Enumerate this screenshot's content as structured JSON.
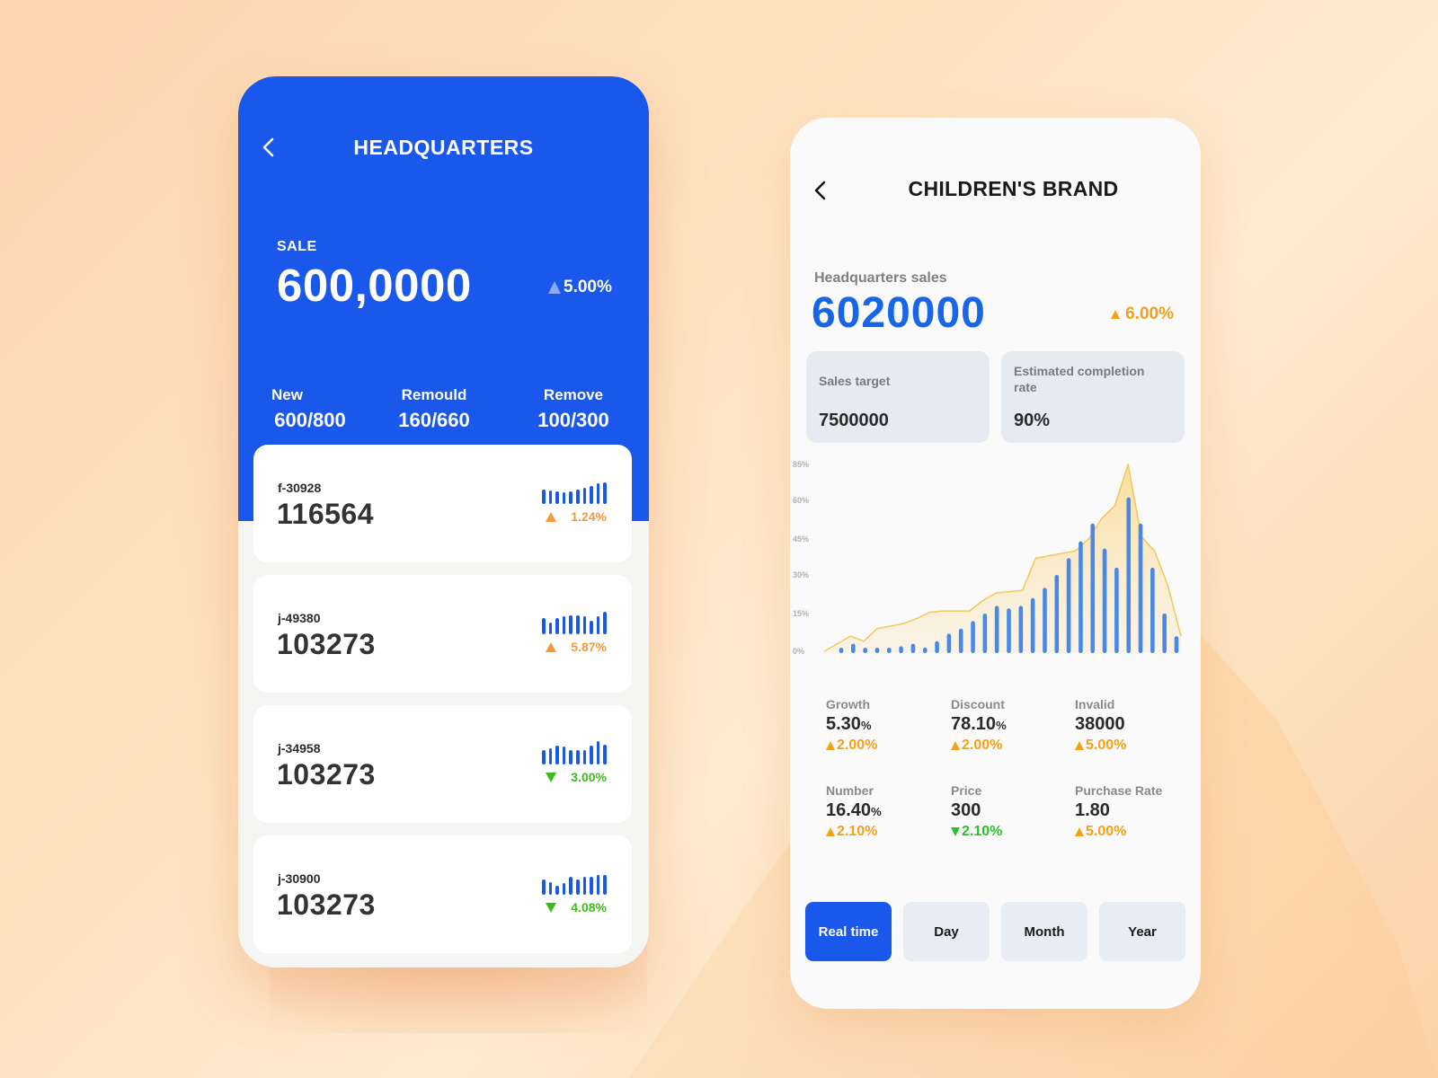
{
  "colors": {
    "brand_blue": "#1a58eb",
    "accent_orange": "#f5a018",
    "up_orange": "#f59a3c",
    "down_green": "#3dbb1a",
    "area_fill": "#f9d98a",
    "area_line": "#f3c75a",
    "bar_blue": "#4a88e8"
  },
  "headquarters": {
    "back_icon": "chevron-left-icon",
    "title": "HEADQUARTERS",
    "sale_label": "SALE",
    "sale_value": "600,0000",
    "sale_change": "5.00%",
    "sale_change_direction": "up",
    "stats": [
      {
        "label": "New",
        "value": "600/800"
      },
      {
        "label": "Remould",
        "value": "160/660"
      },
      {
        "label": "Remove",
        "value": "100/300"
      }
    ],
    "items": [
      {
        "code": "f-30928",
        "value": "116564",
        "change": "1.24%",
        "direction": "up",
        "sparkline": [
          0.62,
          0.58,
          0.55,
          0.5,
          0.55,
          0.6,
          0.68,
          0.78,
          0.88,
          0.92
        ]
      },
      {
        "code": "j-49380",
        "value": "103273",
        "change": "5.87%",
        "direction": "up",
        "sparkline": [
          0.68,
          0.5,
          0.68,
          0.75,
          0.82,
          0.82,
          0.75,
          0.58,
          0.78,
          0.98
        ]
      },
      {
        "code": "j-34958",
        "value": "103273",
        "change": "3.00%",
        "direction": "down",
        "sparkline": [
          0.62,
          0.68,
          0.8,
          0.75,
          0.62,
          0.62,
          0.62,
          0.8,
          1.0,
          0.86
        ]
      },
      {
        "code": "j-30900",
        "value": "103273",
        "change": "4.08%",
        "direction": "down",
        "sparkline": [
          0.65,
          0.52,
          0.4,
          0.5,
          0.78,
          0.65,
          0.78,
          0.78,
          0.85,
          0.85
        ]
      }
    ]
  },
  "brand": {
    "back_icon": "chevron-left-icon",
    "title": "CHILDREN'S BRAND",
    "hq_sales_label": "Headquarters sales",
    "hq_sales_value": "6020000",
    "hq_sales_change": "6.00%",
    "hq_sales_direction": "up",
    "sales_target_label": "Sales target",
    "sales_target_value": "7500000",
    "completion_label": "Estimated completion rate",
    "completion_value": "90%",
    "metrics": [
      {
        "label": "Growth",
        "value": "5.30",
        "unit": "%",
        "change": "2.00%",
        "direction": "up"
      },
      {
        "label": "Discount",
        "value": "78.10",
        "unit": "%",
        "change": "2.00%",
        "direction": "up"
      },
      {
        "label": "Invalid",
        "value": "38000",
        "unit": "",
        "change": "5.00%",
        "direction": "up"
      },
      {
        "label": "Number",
        "value": "16.40",
        "unit": "%",
        "change": "2.10%",
        "direction": "up"
      },
      {
        "label": "Price",
        "value": "300",
        "unit": "",
        "change": "2.10%",
        "direction": "down"
      },
      {
        "label": "Purchase Rate",
        "value": "1.80",
        "unit": "",
        "change": "5.00%",
        "direction": "up"
      }
    ],
    "range_tabs": [
      {
        "label": "Real time",
        "active": true
      },
      {
        "label": "Day",
        "active": false
      },
      {
        "label": "Month",
        "active": false
      },
      {
        "label": "Year",
        "active": false
      }
    ]
  },
  "chart_data": {
    "type": "bar",
    "title": "",
    "xlabel": "",
    "ylabel": "",
    "y_tick_labels": [
      "0%",
      "15%",
      "30%",
      "45%",
      "60%",
      "85%"
    ],
    "y_tick_values": [
      0,
      15,
      30,
      45,
      60,
      85
    ],
    "grid": false,
    "legend": "none",
    "series": [
      {
        "name": "bars",
        "type": "bar",
        "values": [
          0.5,
          3,
          0.5,
          0.5,
          0.5,
          2,
          3,
          1.5,
          4,
          7,
          9,
          12,
          15,
          18,
          17,
          18,
          21,
          25,
          30,
          37,
          44,
          51,
          41,
          33,
          62,
          51,
          33,
          15,
          6
        ]
      },
      {
        "name": "area",
        "type": "area",
        "values": [
          0,
          3,
          6,
          4,
          9,
          10,
          11,
          13,
          15.5,
          16,
          16,
          16,
          20,
          23,
          23.5,
          24,
          37,
          38,
          39,
          40,
          45,
          53,
          58,
          86,
          46,
          40,
          26,
          6
        ]
      }
    ]
  }
}
